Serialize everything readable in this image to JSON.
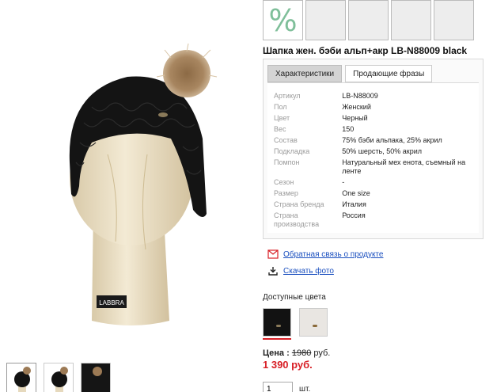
{
  "badges": {
    "promo_symbol": "%",
    "accent_color": "#7fbf9a"
  },
  "product": {
    "title": "Шапка жен. бэби альп+акр LB-N88009 black",
    "brand_mark": "LABBRA"
  },
  "tabs": [
    {
      "label": "Характеристики",
      "active": true
    },
    {
      "label": "Продающие фразы",
      "active": false
    }
  ],
  "specs": [
    {
      "key": "Артикул",
      "value": "LB-N88009"
    },
    {
      "key": "Пол",
      "value": "Женский"
    },
    {
      "key": "Цвет",
      "value": "Черный"
    },
    {
      "key": "Вес",
      "value": "150"
    },
    {
      "key": "Состав",
      "value": "75% бэби альпака, 25% акрил"
    },
    {
      "key": "Подкладка",
      "value": "50% шерсть, 50% акрил"
    },
    {
      "key": "Помпон",
      "value": "Натуральный мех енота, съемный на ленте"
    },
    {
      "key": "Сезон",
      "value": "-"
    },
    {
      "key": "Размер",
      "value": "One size"
    },
    {
      "key": "Страна бренда",
      "value": "Италия"
    },
    {
      "key": "Страна производства",
      "value": "Россия"
    }
  ],
  "links": {
    "feedback": "Обратная связь о продукте",
    "download": "Скачать фото"
  },
  "colors": {
    "label": "Доступные цвета",
    "selected_color": "#d81f26"
  },
  "price": {
    "label": "Цена :",
    "old": "1980",
    "currency": "руб.",
    "new": "1 390 руб."
  },
  "quantity": {
    "value": "1",
    "unit": "шт."
  }
}
